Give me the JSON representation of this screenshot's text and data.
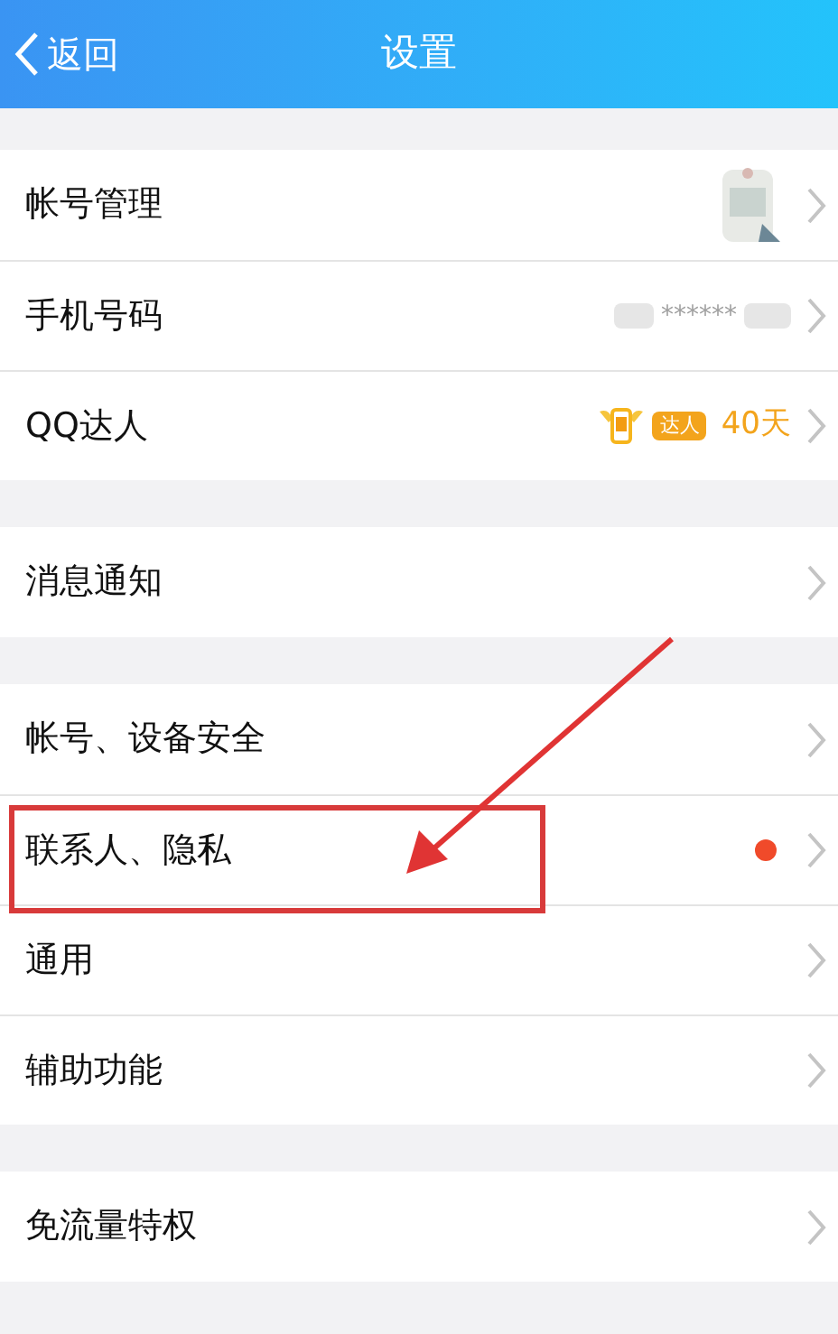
{
  "header": {
    "back": "返回",
    "title": "设置"
  },
  "groups": [
    {
      "items": [
        {
          "label": "帐号管理",
          "kind": "avatar",
          "highlighted": false
        },
        {
          "label": "手机号码",
          "kind": "masked",
          "value": "******",
          "highlighted": false
        },
        {
          "label": "QQ达人",
          "kind": "badge",
          "badge": "达人",
          "value": "40天",
          "highlighted": false
        }
      ]
    },
    {
      "items": [
        {
          "label": "消息通知",
          "kind": "plain",
          "highlighted": false
        }
      ]
    },
    {
      "items": [
        {
          "label": "帐号、设备安全",
          "kind": "plain",
          "highlighted": false
        },
        {
          "label": "联系人、隐私",
          "kind": "dot",
          "color": "#f04a2a",
          "highlighted": true
        },
        {
          "label": "通用",
          "kind": "plain",
          "highlighted": false
        },
        {
          "label": "辅助功能",
          "kind": "plain",
          "highlighted": false
        }
      ]
    },
    {
      "items": [
        {
          "label": "免流量特权",
          "kind": "plain",
          "highlighted": false
        }
      ]
    }
  ]
}
